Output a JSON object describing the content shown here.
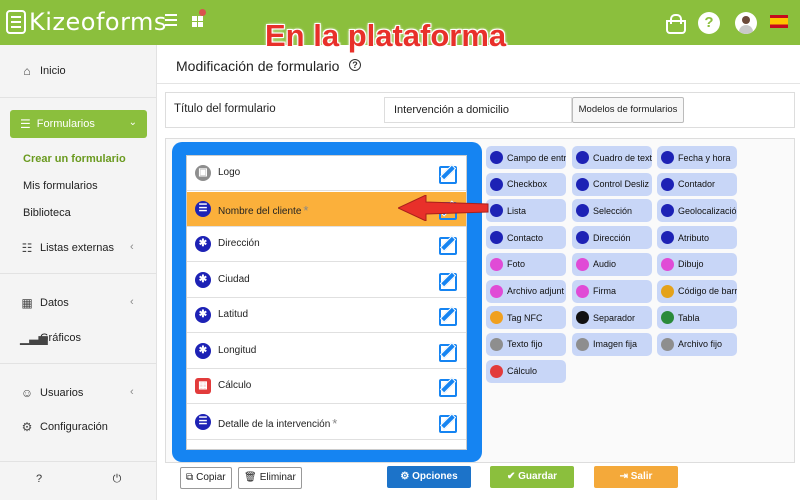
{
  "brand": {
    "logo_text": "Kizeoforms"
  },
  "overlay": {
    "title": "En la plataforma"
  },
  "colors": {
    "brand_green": "#8bbf3d",
    "panel_blue": "#1584f2",
    "highlight_orange": "#fbb03b",
    "palette_bg": "#c8d6f7",
    "icon_navy": "#1d22b5",
    "annotation_red": "#e8302a",
    "options_blue": "#1c73c9",
    "save_green": "#8bbf3d",
    "exit_orange": "#f4a93a"
  },
  "sidebar": {
    "inicio": "Inicio",
    "formularios": "Formularios",
    "sub": [
      "Crear un formulario",
      "Mis formularios",
      "Biblioteca"
    ],
    "listas": "Listas externas",
    "datos": "Datos",
    "graficos": "Gráficos",
    "usuarios": "Usuarios",
    "configuracion": "Configuración"
  },
  "page": {
    "title": "Modificación de formulario",
    "form_title_label": "Título del formulario",
    "form_title_value": "Intervención a domicilio",
    "models_button": "Modelos de formularios"
  },
  "fields": [
    {
      "label": "Logo",
      "icon": "image-icon",
      "required": false
    },
    {
      "label": "Nombre del cliente",
      "icon": "list-icon",
      "required": true
    },
    {
      "label": "Dirección",
      "icon": "asterisk-icon",
      "required": false
    },
    {
      "label": "Ciudad",
      "icon": "asterisk-icon",
      "required": false
    },
    {
      "label": "Latitud",
      "icon": "asterisk-icon",
      "required": false
    },
    {
      "label": "Longitud",
      "icon": "asterisk-icon",
      "required": false
    },
    {
      "label": "Cálculo",
      "icon": "calculator-icon",
      "required": false
    },
    {
      "label": "Detalle de la intervención",
      "icon": "list-icon",
      "required": true
    }
  ],
  "required_mark": "*",
  "palette": [
    [
      "Campo de entr",
      "Cuadro de text",
      "Fecha y hora"
    ],
    [
      "Checkbox",
      "Control Desliz",
      "Contador"
    ],
    [
      "Lista",
      "Selección",
      "Geolocalizació"
    ],
    [
      "Contacto",
      "Dirección",
      "Atributo"
    ],
    [
      "Foto",
      "Audio",
      "Dibujo"
    ],
    [
      "Archivo adjunt",
      "Firma",
      "Código de barr"
    ],
    [
      "Tag NFC",
      "Separador",
      "Tabla"
    ],
    [
      "Texto fijo",
      "Imagen fija",
      "Archivo fijo"
    ],
    [
      "Cálculo"
    ]
  ],
  "buttons": {
    "copy": "Copiar",
    "delete": "Eliminar",
    "options": "Opciones",
    "save": "Guardar",
    "exit": "Salir"
  }
}
